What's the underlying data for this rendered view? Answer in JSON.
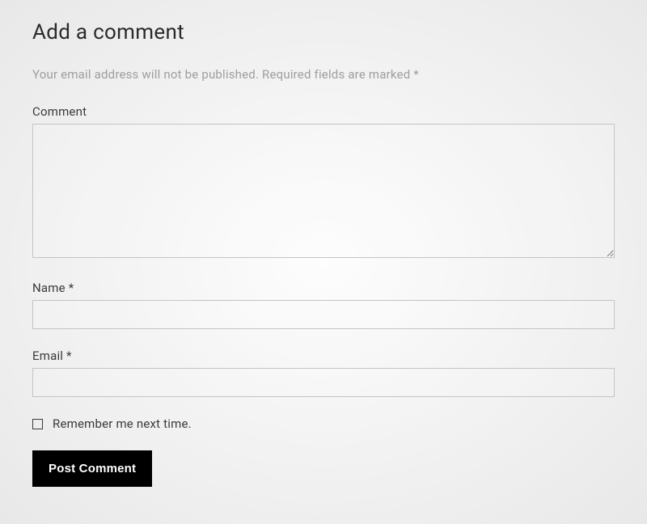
{
  "form": {
    "title": "Add a comment",
    "notice": "Your email address will not be published. Required fields are marked *",
    "comment": {
      "label": "Comment",
      "value": ""
    },
    "name": {
      "label": "Name *",
      "value": ""
    },
    "email": {
      "label": "Email *",
      "value": ""
    },
    "remember": {
      "label": "Remember me next time.",
      "checked": false
    },
    "submit": {
      "label": "Post Comment"
    }
  }
}
